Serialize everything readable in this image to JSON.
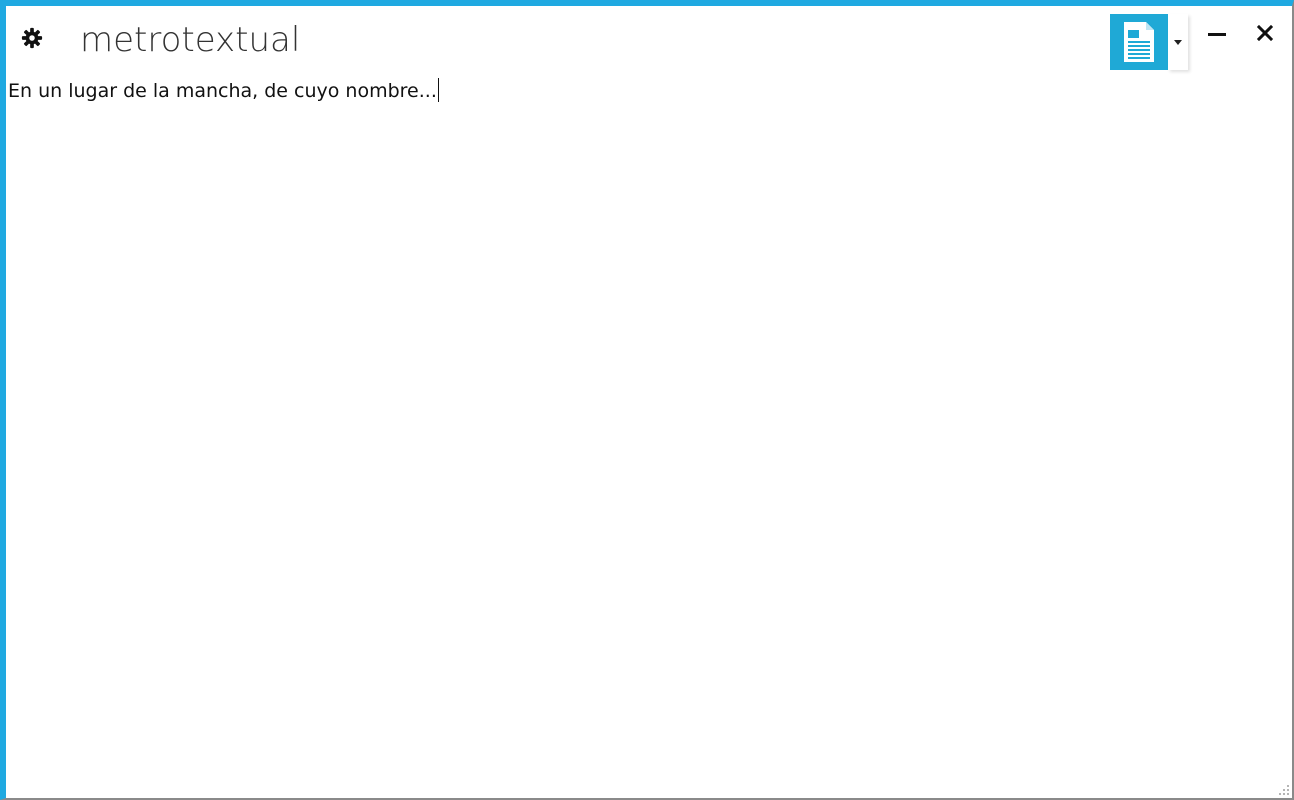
{
  "window": {
    "title": "metrotextual",
    "accent_color": "#1fa9e1"
  },
  "titlebar": {
    "settings_icon": "gear-icon",
    "document_icon": "document-icon",
    "dropdown_icon": "caret-down-icon",
    "minimize_icon": "minimize-icon",
    "close_icon": "close-icon"
  },
  "editor": {
    "content": "En un lugar de la mancha, de cuyo nombre..."
  }
}
